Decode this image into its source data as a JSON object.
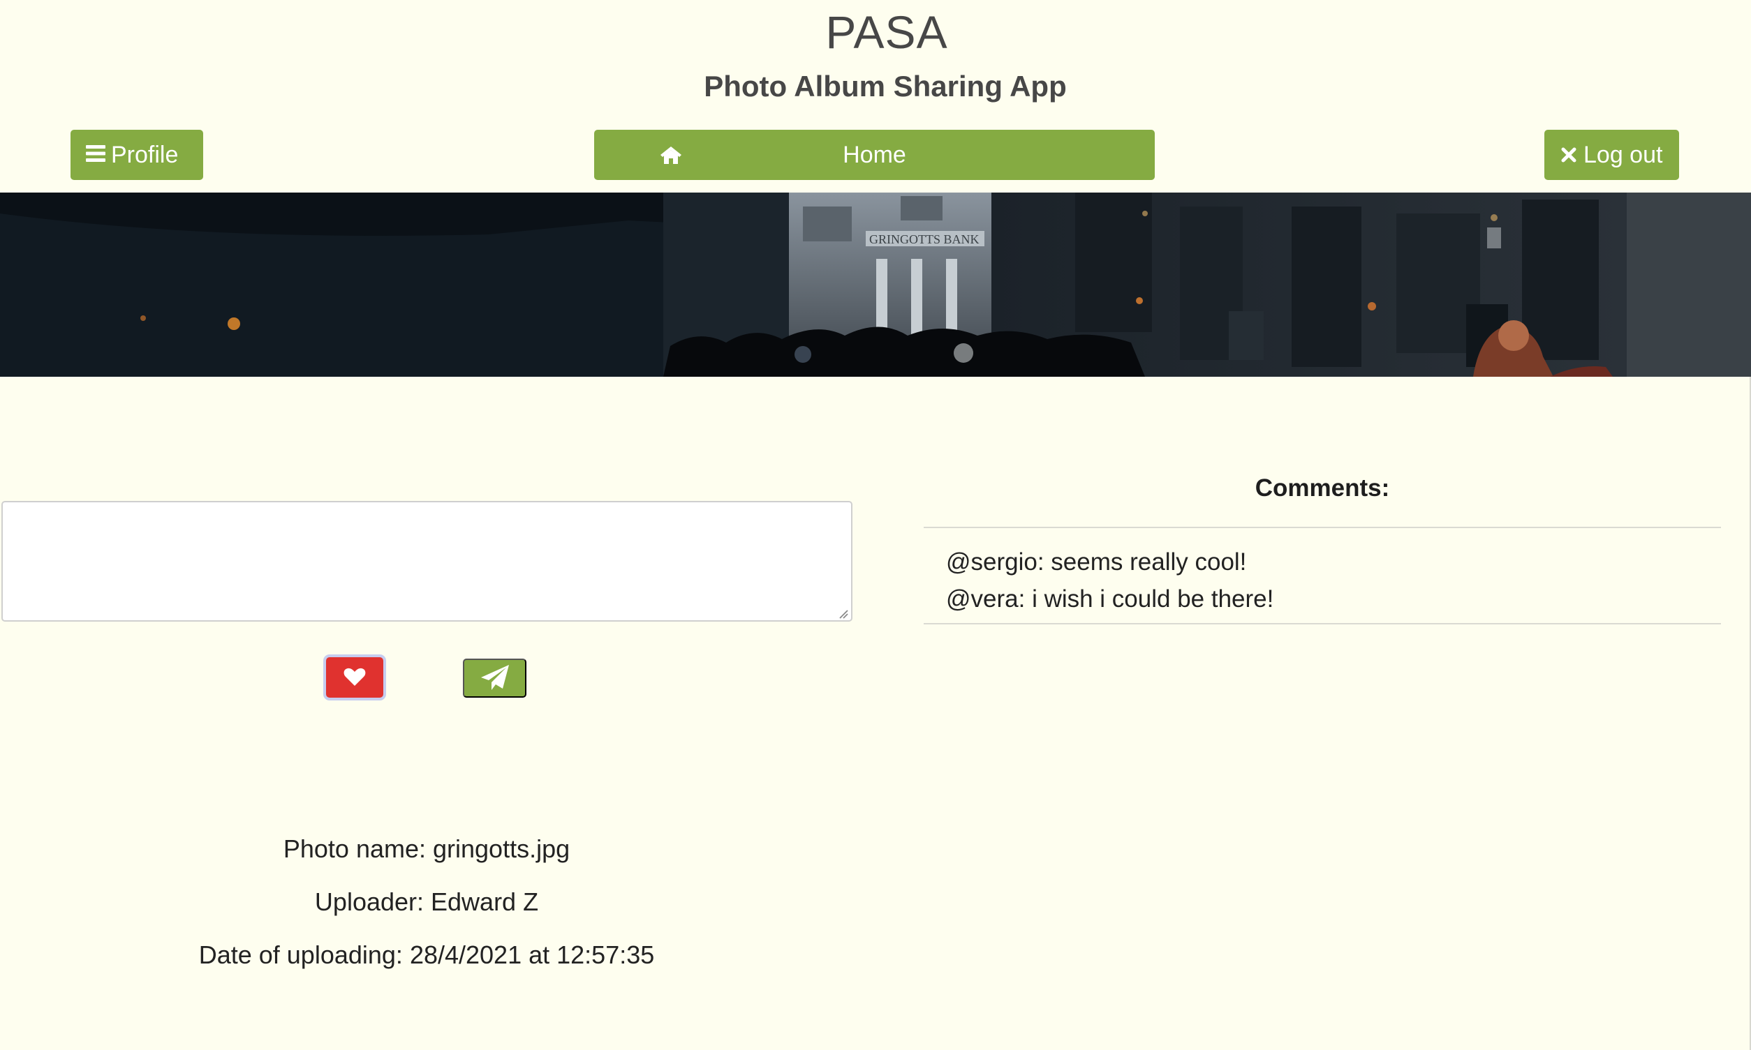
{
  "header": {
    "title": "PASA",
    "subtitle": "Photo Album Sharing App"
  },
  "nav": {
    "profile_label": "Profile",
    "home_label": "Home",
    "logout_label": "Log out"
  },
  "colors": {
    "accent": "#85ab42",
    "background": "#fefeef",
    "like": "#e0322f"
  },
  "icons": {
    "profile": "bars-icon",
    "home": "home-icon",
    "logout": "close-icon",
    "like": "heart-icon",
    "send": "paper-plane-icon"
  },
  "comment_form": {
    "value": "",
    "placeholder": ""
  },
  "photo": {
    "name_line": "Photo name: gringotts.jpg",
    "uploader_line": "Uploader: Edward Z",
    "date_line": "Date of uploading: 28/4/2021 at 12:57:35"
  },
  "comments": {
    "heading": "Comments:",
    "items": [
      "@sergio: seems really cool!",
      "@vera: i wish i could be there!"
    ]
  }
}
